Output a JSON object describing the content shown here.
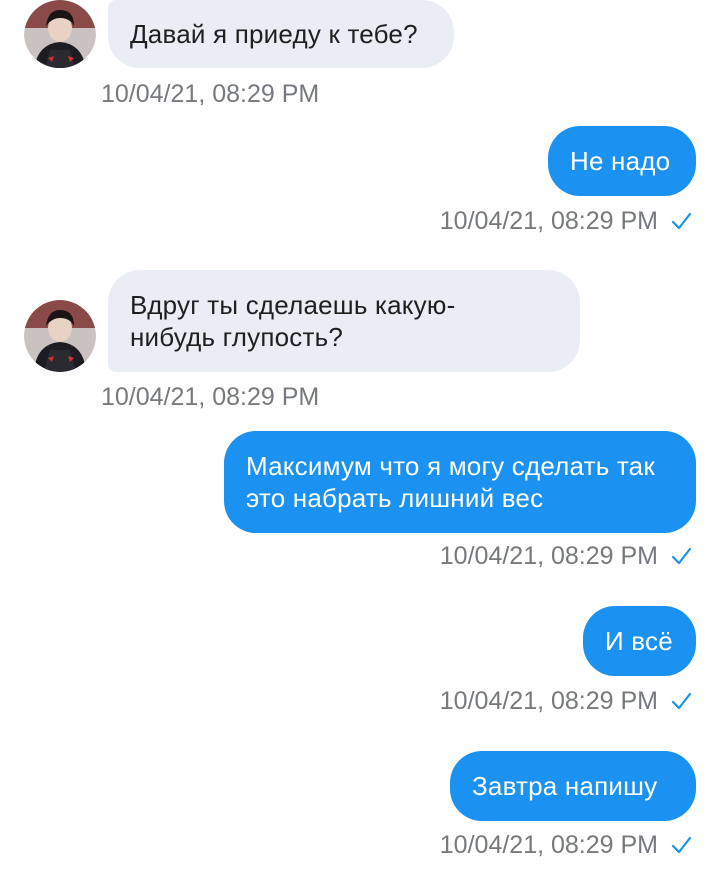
{
  "messages": [
    {
      "direction": "incoming",
      "text": "Давай я приеду к тебе?",
      "timestamp": "10/04/21, 08:29 PM"
    },
    {
      "direction": "outgoing",
      "text": "Не надо",
      "timestamp": "10/04/21, 08:29 PM",
      "status_icon": "check-icon"
    },
    {
      "direction": "incoming",
      "text": "Вдруг ты сделаешь какую-нибудь глупость?",
      "timestamp": "10/04/21, 08:29 PM"
    },
    {
      "direction": "outgoing",
      "text": "Максимум что я могу сделать так это набрать лишний вес",
      "timestamp": "10/04/21, 08:29 PM",
      "status_icon": "check-icon"
    },
    {
      "direction": "outgoing",
      "text": "И всё",
      "timestamp": "10/04/21, 08:29 PM",
      "status_icon": "check-icon"
    },
    {
      "direction": "outgoing",
      "text": "Завтра напишу",
      "timestamp": "10/04/21, 08:29 PM",
      "status_icon": "check-icon"
    }
  ],
  "colors": {
    "outgoing_bubble": "#1b91f2",
    "incoming_bubble": "#eaedf4",
    "timestamp_text": "#76797e",
    "check_mark": "#1b91f2"
  }
}
